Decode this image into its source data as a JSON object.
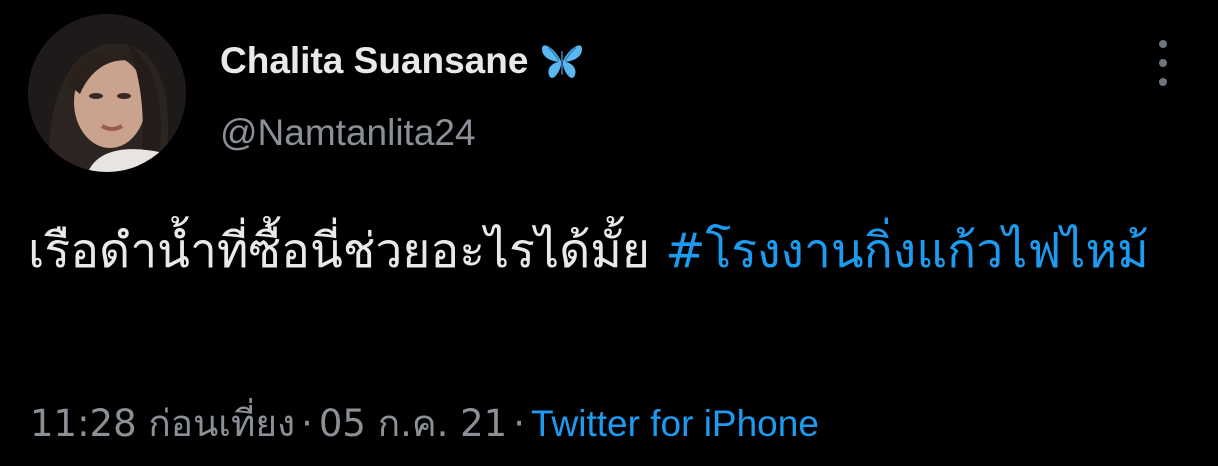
{
  "tweet": {
    "display_name": "Chalita Suansane",
    "verified_icon": "butterfly-emoji",
    "handle": "@Namtanlita24",
    "text_body": "เรือดำน้ำที่ซื้อนี่ช่วยอะไรได้มั้ย ",
    "hashtag": "#โรงงานกิ่งแก้วไฟไหม้",
    "time": "11:28 ก่อนเที่ยง",
    "separator_1": "·",
    "date": "05 ก.ค. 21",
    "separator_2": "·",
    "source": "Twitter for iPhone"
  },
  "colors": {
    "background": "#000000",
    "text": "#e7e9ea",
    "secondary_text": "#8b9096",
    "link": "#1d9bf0"
  },
  "icons": {
    "more": "vertical-dots-icon",
    "verified": "butterfly-icon"
  }
}
